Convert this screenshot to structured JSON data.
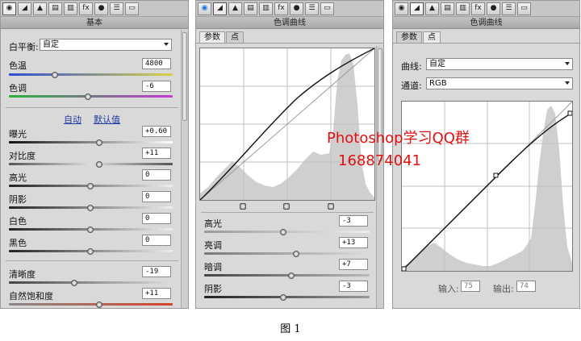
{
  "panel1": {
    "title": "基本",
    "white_balance_label": "白平衡:",
    "white_balance_value": "自定",
    "temp_label": "色温",
    "temp_value": "4800",
    "tint_label": "色调",
    "tint_value": "-6",
    "auto_link": "自动",
    "default_link": "默认值",
    "sliders": [
      {
        "label": "曝光",
        "value": "+0.60"
      },
      {
        "label": "对比度",
        "value": "+11"
      },
      {
        "label": "高光",
        "value": "0"
      },
      {
        "label": "阴影",
        "value": "0"
      },
      {
        "label": "白色",
        "value": "0"
      },
      {
        "label": "黑色",
        "value": "0"
      },
      {
        "label": "清晰度",
        "value": "-19"
      },
      {
        "label": "自然饱和度",
        "value": "+11"
      }
    ]
  },
  "panel2": {
    "title": "色调曲线",
    "tab_parametric": "参数",
    "tab_point": "点",
    "sliders": [
      {
        "label": "高光",
        "value": "-3"
      },
      {
        "label": "亮调",
        "value": "+13"
      },
      {
        "label": "暗调",
        "value": "+7"
      },
      {
        "label": "阴影",
        "value": "-3"
      }
    ]
  },
  "panel3": {
    "title": "色调曲线",
    "tab_parametric": "参数",
    "tab_point": "点",
    "curve_label": "曲线:",
    "curve_value": "自定",
    "channel_label": "通道:",
    "channel_value": "RGB",
    "input_label": "输入:",
    "input_value": "75",
    "output_label": "输出:",
    "output_value": "74"
  },
  "toolbar": {
    "icons": [
      "aperture-icon",
      "tone-curve-icon",
      "mountain-icon",
      "split-icon",
      "hsl-icon",
      "fx-icon",
      "camera-icon",
      "presets-icon",
      "snapshot-icon"
    ],
    "fx_glyph": "fx"
  },
  "watermark": {
    "line1": "Photoshop学习QQ群",
    "line2": "168874041"
  },
  "caption": "图 1",
  "colors": {
    "panel_bg": "#d9d9d9",
    "watermark": "#e01010",
    "link": "#1f3aa3"
  }
}
